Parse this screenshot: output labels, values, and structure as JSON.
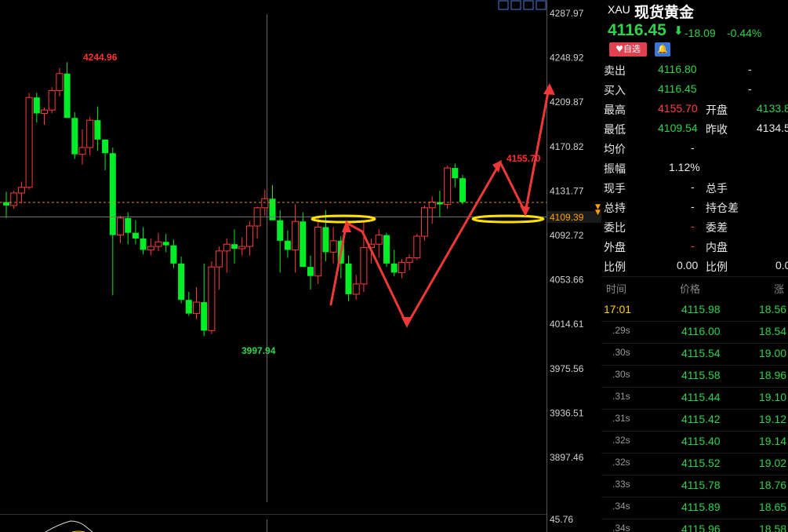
{
  "chart_data": {
    "type": "candlestick",
    "y_ticks": [
      4287.97,
      4248.92,
      4209.87,
      4170.82,
      4131.77,
      4092.72,
      4053.66,
      4014.61,
      3975.56,
      3936.51,
      3897.46
    ],
    "ylim": [
      3878,
      4300
    ],
    "current_price_label": "4109.39",
    "high_label": "4244.96",
    "low_label": "3997.94",
    "recent_high_label": "4155.70",
    "volume_axis_label": "45.76",
    "candles": [
      [
        4122,
        4131,
        4108,
        4119
      ],
      [
        4119,
        4132,
        4116,
        4130
      ],
      [
        4130,
        4140,
        4121,
        4135
      ],
      [
        4135,
        4218,
        4133,
        4214
      ],
      [
        4214,
        4218,
        4192,
        4200
      ],
      [
        4200,
        4205,
        4190,
        4203
      ],
      [
        4203,
        4223,
        4200,
        4220
      ],
      [
        4220,
        4240,
        4215,
        4235
      ],
      [
        4235,
        4245,
        4205,
        4196
      ],
      [
        4196,
        4201,
        4160,
        4164
      ],
      [
        4164,
        4186,
        4155,
        4170
      ],
      [
        4170,
        4197,
        4163,
        4194
      ],
      [
        4194,
        4206,
        4167,
        4177
      ],
      [
        4177,
        4172,
        4150,
        4165
      ],
      [
        4165,
        4170,
        4040,
        4093
      ],
      [
        4093,
        4110,
        4086,
        4108
      ],
      [
        4108,
        4113,
        4085,
        4095
      ],
      [
        4095,
        4106,
        4085,
        4090
      ],
      [
        4090,
        4100,
        4076,
        4080
      ],
      [
        4080,
        4090,
        4075,
        4083
      ],
      [
        4083,
        4095,
        4079,
        4087
      ],
      [
        4087,
        4094,
        4078,
        4084
      ],
      [
        4084,
        4089,
        4064,
        4068
      ],
      [
        4068,
        4074,
        4033,
        4036
      ],
      [
        4036,
        4043,
        4022,
        4024
      ],
      [
        4024,
        4047,
        4019,
        4034
      ],
      [
        4034,
        4068,
        4004,
        4009
      ],
      [
        4009,
        4070,
        4006,
        4065
      ],
      [
        4065,
        4083,
        4045,
        4079
      ],
      [
        4079,
        4090,
        4060,
        4085
      ],
      [
        4085,
        4098,
        4068,
        4081
      ],
      [
        4081,
        4091,
        4075,
        4083
      ],
      [
        4083,
        4105,
        4075,
        4101
      ],
      [
        4101,
        4118,
        4090,
        4117
      ],
      [
        4117,
        4133,
        4110,
        4125
      ],
      [
        4125,
        4137,
        4112,
        4106
      ],
      [
        4106,
        4115,
        4060,
        4088
      ],
      [
        4088,
        4097,
        4073,
        4080
      ],
      [
        4080,
        4120,
        4060,
        4105
      ],
      [
        4105,
        4113,
        4074,
        4065
      ],
      [
        4065,
        4075,
        4045,
        4057
      ],
      [
        4057,
        4110,
        4050,
        4100
      ],
      [
        4100,
        4115,
        4070,
        4078
      ],
      [
        4078,
        4100,
        4068,
        4088
      ],
      [
        4088,
        4092,
        4055,
        4068
      ],
      [
        4068,
        4075,
        4035,
        4041
      ],
      [
        4041,
        4058,
        4036,
        4050
      ],
      [
        4050,
        4105,
        4043,
        4082
      ],
      [
        4082,
        4090,
        4068,
        4085
      ],
      [
        4085,
        4098,
        4073,
        4093
      ],
      [
        4093,
        4095,
        4065,
        4068
      ],
      [
        4068,
        4080,
        4057,
        4060
      ],
      [
        4060,
        4072,
        4055,
        4069
      ],
      [
        4069,
        4076,
        4062,
        4073
      ],
      [
        4073,
        4094,
        4071,
        4092
      ],
      [
        4092,
        4119,
        4088,
        4117
      ],
      [
        4117,
        4127,
        4103,
        4122
      ],
      [
        4122,
        4132,
        4109,
        4120
      ],
      [
        4120,
        4154,
        4116,
        4152
      ],
      [
        4152,
        4156,
        4135,
        4143
      ],
      [
        4143,
        4146,
        4120,
        4122
      ]
    ]
  },
  "panel": {
    "symbol": "XAU",
    "name": "现货黄金",
    "price": "4116.45",
    "arrow": "⬇",
    "change": "-18.09",
    "change_pct": "-0.44%",
    "fav_label": "自选",
    "colors": {
      "up": "#ff4040",
      "down": "#2fd24a",
      "accent": "#ffd000"
    },
    "quotes": [
      {
        "l1": "卖出",
        "v1": "4116.80",
        "v1c": "green",
        "l2": "",
        "v2": "-",
        "v2c": "white"
      },
      {
        "l1": "买入",
        "v1": "4116.45",
        "v1c": "green",
        "l2": "",
        "v2": "-",
        "v2c": "white"
      },
      {
        "l1": "最高",
        "v1": "4155.70",
        "v1c": "red",
        "l2": "开盘",
        "v2": "4133.8",
        "v2c": "green"
      },
      {
        "l1": "最低",
        "v1": "4109.54",
        "v1c": "green",
        "l2": "昨收",
        "v2": "4134.5",
        "v2c": "white"
      },
      {
        "l1": "均价",
        "v1": "-",
        "v1c": "white",
        "l2": "",
        "v2": "",
        "v2c": "white"
      },
      {
        "l1": "振幅",
        "v1": "1.12%",
        "v1c": "white",
        "l2": "",
        "v2": "",
        "v2c": "white"
      },
      {
        "l1": "现手",
        "v1": "-",
        "v1c": "white",
        "l2": "总手",
        "v2": "",
        "v2c": "white"
      },
      {
        "l1": "总持",
        "v1": "-",
        "v1c": "white",
        "l2": "持仓差",
        "v2": "",
        "v2c": "white"
      },
      {
        "l1": "委比",
        "v1": "-",
        "v1c": "red",
        "l2": "委差",
        "v2": "",
        "v2c": "white"
      },
      {
        "l1": "外盘",
        "v1": "-",
        "v1c": "red",
        "l2": "内盘",
        "v2": "",
        "v2c": "white"
      },
      {
        "l1": "比例",
        "v1": "0.00",
        "v1c": "white",
        "l2": "比例",
        "v2": "0.0",
        "v2c": "white"
      }
    ],
    "ticks_header": [
      "时间",
      "价格",
      "涨"
    ],
    "ticks": [
      {
        "t": "17:01",
        "p": "4115.98",
        "c": "18.56",
        "hl": true
      },
      {
        "t": ".29s",
        "p": "4116.00",
        "c": "18.54",
        "hl": false
      },
      {
        "t": ".30s",
        "p": "4115.54",
        "c": "19.00",
        "hl": false
      },
      {
        "t": ".30s",
        "p": "4115.58",
        "c": "18.96",
        "hl": false
      },
      {
        "t": ".31s",
        "p": "4115.44",
        "c": "19.10",
        "hl": false
      },
      {
        "t": ".31s",
        "p": "4115.42",
        "c": "19.12",
        "hl": false
      },
      {
        "t": ".32s",
        "p": "4115.40",
        "c": "19.14",
        "hl": false
      },
      {
        "t": ".32s",
        "p": "4115.52",
        "c": "19.02",
        "hl": false
      },
      {
        "t": ".33s",
        "p": "4115.78",
        "c": "18.76",
        "hl": false
      },
      {
        "t": ".34s",
        "p": "4115.89",
        "c": "18.65",
        "hl": false
      },
      {
        "t": ".34s",
        "p": "4115.96",
        "c": "18.58",
        "hl": false
      }
    ]
  }
}
